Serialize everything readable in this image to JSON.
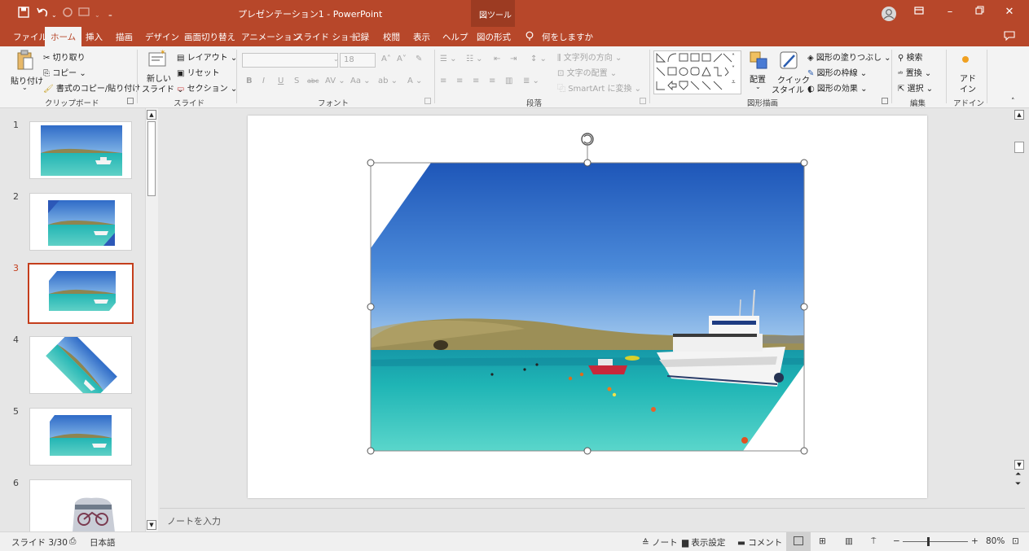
{
  "titlebar": {
    "doc_title": "プレゼンテーション1 - PowerPoint",
    "context_group": "図ツール",
    "tell_me": "何をしますか"
  },
  "tabs": [
    "ファイル",
    "ホーム",
    "挿入",
    "描画",
    "デザイン",
    "画面切り替え",
    "アニメーション",
    "スライド ショー",
    "記録",
    "校閲",
    "表示",
    "ヘルプ",
    "図の形式"
  ],
  "ribbon": {
    "clipboard": {
      "paste": "貼り付け",
      "cut": "切り取り",
      "copy": "コピー",
      "format_painter": "書式のコピー/貼り付け",
      "label": "クリップボード"
    },
    "slides": {
      "new_slide_1": "新しい",
      "new_slide_2": "スライド",
      "layout": "レイアウト",
      "reset": "リセット",
      "section": "セクション",
      "label": "スライド"
    },
    "font": {
      "size": "18",
      "label": "フォント"
    },
    "paragraph": {
      "text_direction": "文字列の方向",
      "align_text": "文字の配置",
      "smartart": "SmartArt に変換",
      "label": "段落"
    },
    "drawing": {
      "arrange": "配置",
      "quick_styles_1": "クイック",
      "quick_styles_2": "スタイル",
      "shape_fill": "図形の塗りつぶし",
      "shape_outline": "図形の枠線",
      "shape_effects": "図形の効果",
      "label": "図形描画"
    },
    "editing": {
      "find": "検索",
      "replace": "置換",
      "select": "選択",
      "label": "編集"
    },
    "addins": {
      "btn_1": "アド",
      "btn_2": "イン",
      "label": "アドイン"
    }
  },
  "slides": [
    {
      "num": "1"
    },
    {
      "num": "2"
    },
    {
      "num": "3"
    },
    {
      "num": "4"
    },
    {
      "num": "5"
    },
    {
      "num": "6"
    }
  ],
  "selected_slide": "3",
  "notes_placeholder": "ノートを入力",
  "status": {
    "slide_info": "スライド 3/30",
    "language": "日本語",
    "notes": "ノート",
    "display_settings": "表示設定",
    "comments": "コメント",
    "zoom": "80%",
    "zoom_minus": "−",
    "zoom_plus": "+"
  },
  "colors": {
    "accent": "#b7472a",
    "selection": "#c43e1c"
  }
}
